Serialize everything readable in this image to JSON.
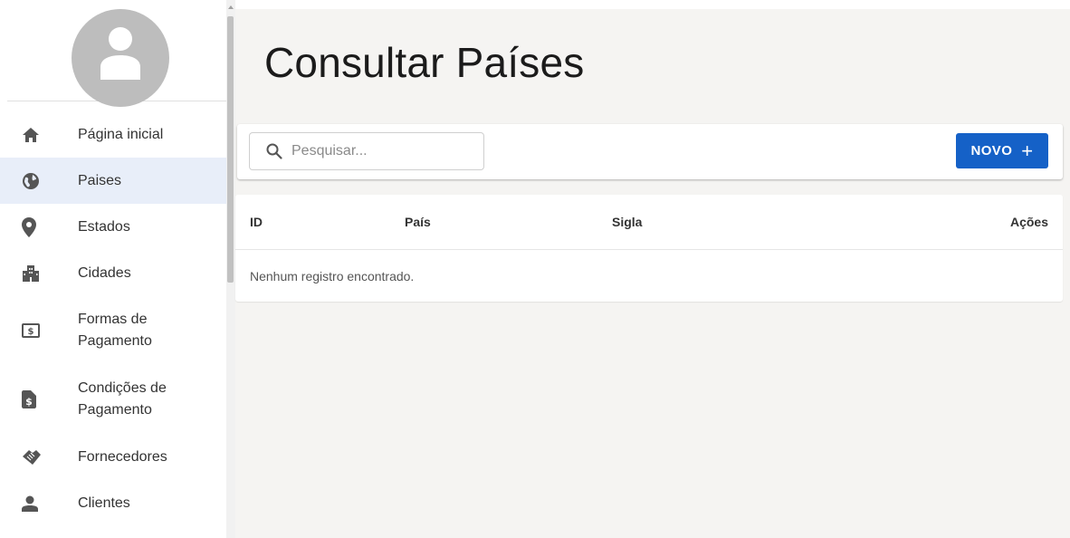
{
  "sidebar": {
    "items": [
      {
        "label": "Página inicial",
        "icon": "home-icon"
      },
      {
        "label": "Paises",
        "icon": "globe-icon",
        "active": true
      },
      {
        "label": "Estados",
        "icon": "location-pin-icon"
      },
      {
        "label": "Cidades",
        "icon": "city-icon"
      },
      {
        "label": "Formas de Pagamento",
        "icon": "money-icon"
      },
      {
        "label": "Condições de Pagamento",
        "icon": "invoice-icon"
      },
      {
        "label": "Fornecedores",
        "icon": "handshake-icon"
      },
      {
        "label": "Clientes",
        "icon": "person-icon"
      }
    ]
  },
  "main": {
    "title": "Consultar Países",
    "search": {
      "placeholder": "Pesquisar...",
      "value": ""
    },
    "new_button": {
      "label": "NOVO",
      "icon": "+"
    },
    "table": {
      "columns": [
        "ID",
        "País",
        "Sigla",
        "Ações"
      ],
      "empty_message": "Nenhum registro encontrado."
    }
  },
  "colors": {
    "accent": "#1561c7",
    "active_bg": "#e8eef9",
    "main_bg": "#f5f4f2",
    "avatar": "#bdbdbd"
  }
}
